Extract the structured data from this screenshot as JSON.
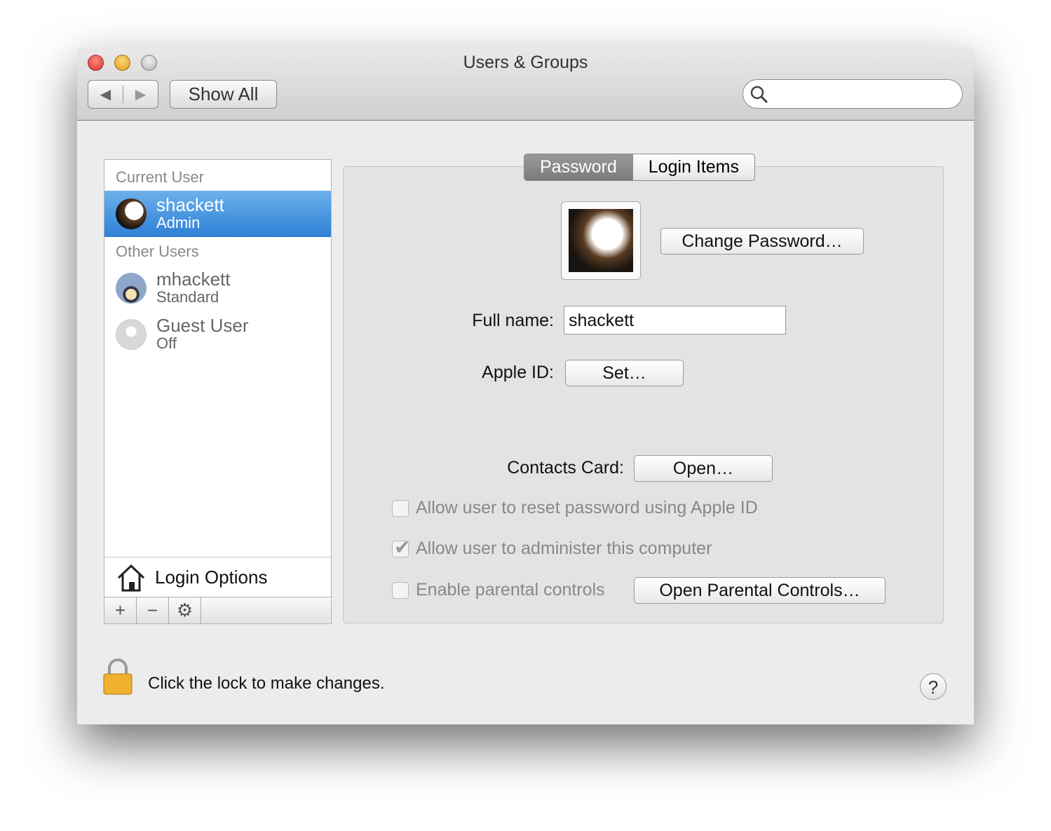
{
  "window": {
    "title": "Users & Groups"
  },
  "toolbar": {
    "back": "◀",
    "forward": "▶",
    "show_all": "Show All",
    "search_placeholder": ""
  },
  "sidebar": {
    "current_header": "Current User",
    "other_header": "Other Users",
    "users": [
      {
        "name": "shackett",
        "role": "Admin",
        "selected": true
      },
      {
        "name": "mhackett",
        "role": "Standard"
      },
      {
        "name": "Guest User",
        "role": "Off"
      }
    ],
    "login_options": "Login Options",
    "add": "+",
    "remove": "−",
    "gear": "⚙"
  },
  "tabs": [
    "Password",
    "Login Items"
  ],
  "main": {
    "change_password": "Change Password…",
    "full_name_label": "Full name:",
    "full_name_value": "shackett",
    "apple_id_label": "Apple ID:",
    "apple_id_button": "Set…",
    "contacts_label": "Contacts Card:",
    "contacts_button": "Open…",
    "checks": [
      {
        "label": "Allow user to reset password using Apple ID",
        "checked": false
      },
      {
        "label": "Allow user to administer this computer",
        "checked": true
      },
      {
        "label": "Enable parental controls",
        "checked": false
      }
    ],
    "parental_button": "Open Parental Controls…"
  },
  "footer": {
    "lock_text": "Click the lock to make changes.",
    "help": "?"
  }
}
